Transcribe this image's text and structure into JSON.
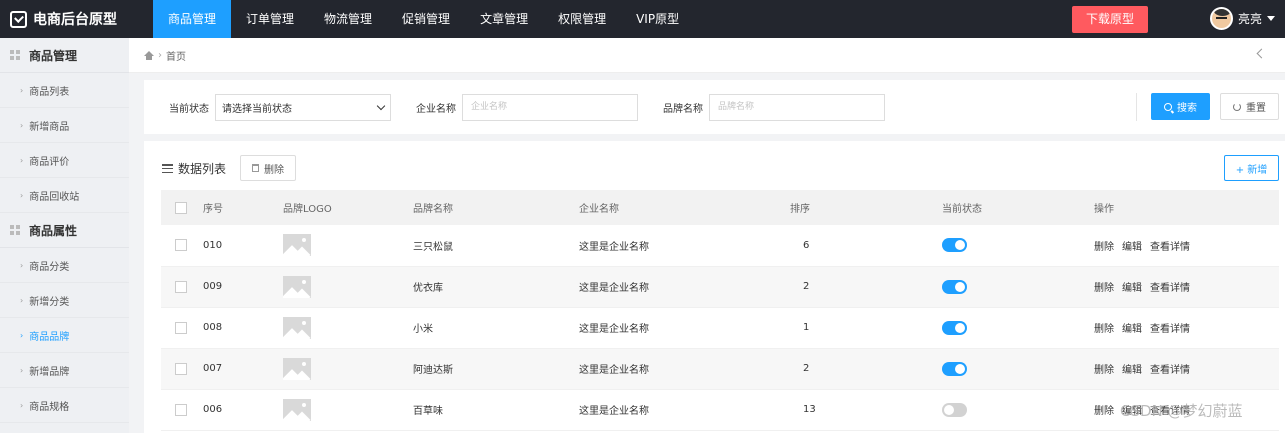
{
  "brand": {
    "title": "电商后台原型"
  },
  "nav": {
    "tabs": [
      {
        "label": "商品管理",
        "active": true
      },
      {
        "label": "订单管理"
      },
      {
        "label": "物流管理"
      },
      {
        "label": "促销管理"
      },
      {
        "label": "文章管理"
      },
      {
        "label": "权限管理"
      },
      {
        "label": "VIP原型"
      }
    ],
    "download_label": "下载原型",
    "user_name": "亮亮"
  },
  "sidebar": {
    "group1": "商品管理",
    "group1_items": [
      "商品列表",
      "新增商品",
      "商品评价",
      "商品回收站"
    ],
    "group2": "商品属性",
    "group2_items": [
      "商品分类",
      "新增分类",
      "商品品牌",
      "新增品牌",
      "商品规格"
    ],
    "active_item": "商品品牌"
  },
  "breadcrumb": {
    "home": "首页"
  },
  "filter": {
    "status_label": "当前状态",
    "status_value": "请选择当前状态",
    "company_label": "企业名称",
    "company_placeholder": "企业名称",
    "brand_label": "品牌名称",
    "brand_placeholder": "品牌名称",
    "search_label": "搜索",
    "reset_label": "重置"
  },
  "list": {
    "title": "数据列表",
    "delete_label": "删除",
    "add_label": "+ 新增",
    "columns": [
      "序号",
      "品牌LOGO",
      "品牌名称",
      "企业名称",
      "排序",
      "当前状态",
      "操作"
    ],
    "rows": [
      {
        "id": "010",
        "brand": "三只松鼠",
        "company": "这里是企业名称",
        "sort": "6",
        "enabled": true
      },
      {
        "id": "009",
        "brand": "优衣库",
        "company": "这里是企业名称",
        "sort": "2",
        "enabled": true
      },
      {
        "id": "008",
        "brand": "小米",
        "company": "这里是企业名称",
        "sort": "1",
        "enabled": true
      },
      {
        "id": "007",
        "brand": "阿迪达斯",
        "company": "这里是企业名称",
        "sort": "2",
        "enabled": true
      },
      {
        "id": "006",
        "brand": "百草味",
        "company": "这里是企业名称",
        "sort": "13",
        "enabled": false
      }
    ],
    "ops": [
      "删除",
      "编辑",
      "查看详情"
    ]
  },
  "watermark": "CSDN @梦幻蔚蓝",
  "colors": {
    "accent": "#1e9fff",
    "topbar": "#23262e",
    "download": "#ff5a5f"
  }
}
